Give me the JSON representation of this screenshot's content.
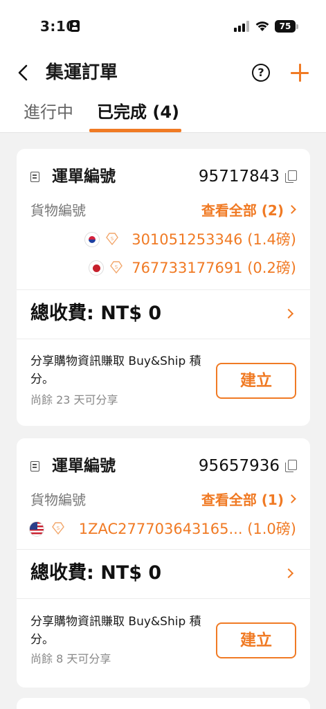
{
  "status_bar": {
    "time": "3:10",
    "battery": "75",
    "icons": [
      "id-card-icon",
      "signal-icon",
      "wifi-icon",
      "battery-icon"
    ]
  },
  "header": {
    "title": "集運訂單",
    "icons": [
      "back-arrow-icon",
      "help-icon",
      "plus-icon"
    ],
    "help_glyph": "?"
  },
  "tabs": [
    {
      "label": "進行中",
      "active": false
    },
    {
      "label": "已完成 (4)",
      "active": true
    }
  ],
  "colors": {
    "accent": "#f07a24",
    "background": "#f2f2f2",
    "card": "#ffffff"
  },
  "orders": [
    {
      "waybill_label": "運單編號",
      "waybill_no": "95717843",
      "goods_label": "貨物編號",
      "view_all": "查看全部 (2)",
      "items": [
        {
          "flag": "korea-flag-icon",
          "text": "301051253346 (1.4磅)"
        },
        {
          "flag": "japan-flag-icon",
          "text": "767733177691 (0.2磅)"
        }
      ],
      "total": "總收費: NT$ 0",
      "share_text": "分享購物資訊賺取 Buy&Ship 積分。",
      "share_remaining": "尚餘 23 天可分享",
      "button": "建立"
    },
    {
      "waybill_label": "運單編號",
      "waybill_no": "95657936",
      "goods_label": "貨物編號",
      "view_all": "查看全部 (1)",
      "items": [
        {
          "flag": "usa-flag-icon",
          "text": "1ZAC277703643165... (1.0磅)"
        }
      ],
      "total": "總收費: NT$ 0",
      "share_text": "分享購物資訊賺取 Buy&Ship 積分。",
      "share_remaining": "尚餘 8 天可分享",
      "button": "建立"
    }
  ]
}
